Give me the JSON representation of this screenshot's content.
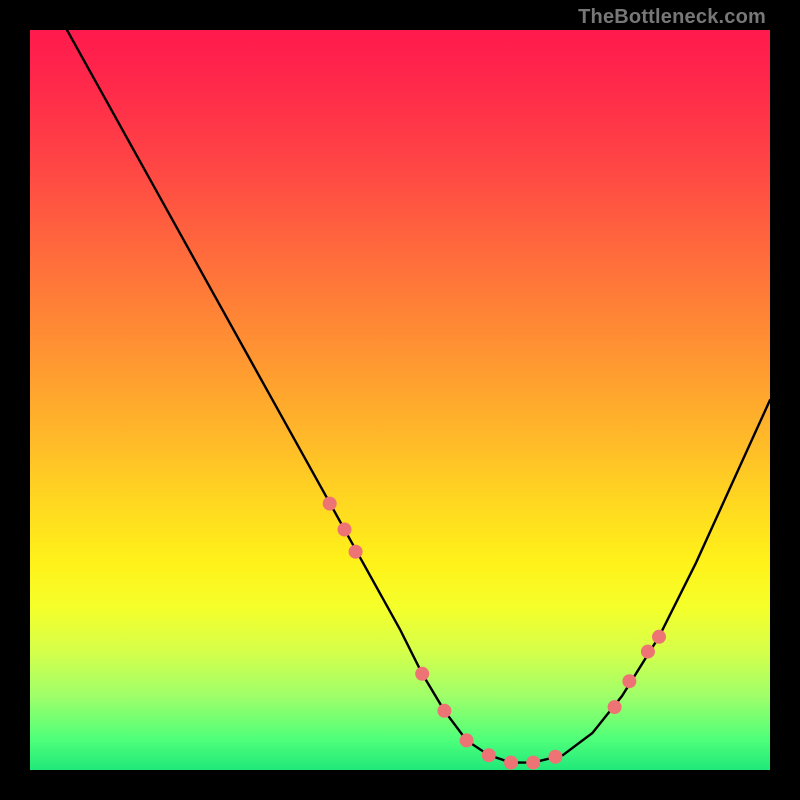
{
  "watermark": "TheBottleneck.com",
  "chart_data": {
    "type": "line",
    "title": "",
    "xlabel": "",
    "ylabel": "",
    "xlim": [
      0,
      100
    ],
    "ylim": [
      0,
      100
    ],
    "grid": false,
    "legend": false,
    "series": [
      {
        "name": "curve",
        "color": "#000000",
        "x": [
          5,
          10,
          15,
          20,
          25,
          30,
          35,
          40,
          45,
          50,
          53,
          56,
          59,
          62,
          65,
          68,
          72,
          76,
          80,
          85,
          90,
          95,
          100
        ],
        "y": [
          100,
          91,
          82,
          73,
          64,
          55,
          46,
          37,
          28,
          19,
          13,
          8,
          4,
          2,
          1,
          1,
          2,
          5,
          10,
          18,
          28,
          39,
          50
        ]
      }
    ],
    "markers": {
      "name": "highlight-dots",
      "color": "#ed7374",
      "radius": 7,
      "x": [
        40.5,
        42.5,
        44.0,
        53.0,
        56.0,
        59.0,
        62.0,
        65.0,
        68.0,
        71.0,
        79.0,
        81.0,
        83.5,
        85.0
      ],
      "y": [
        36.0,
        32.5,
        29.5,
        13.0,
        8.0,
        4.0,
        2.0,
        1.0,
        1.0,
        1.8,
        8.5,
        12.0,
        16.0,
        18.0
      ]
    }
  }
}
